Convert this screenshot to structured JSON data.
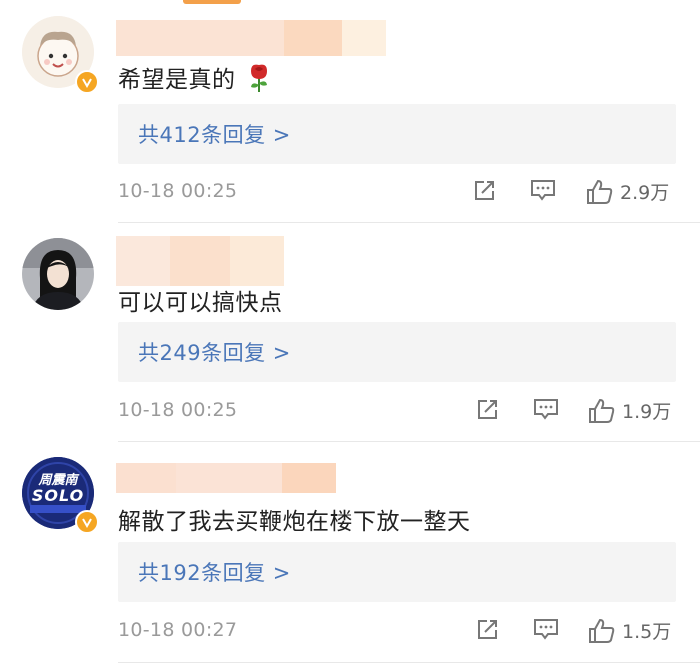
{
  "comments": [
    {
      "content": "希望是真的",
      "replies": "共412条回复 >",
      "time": "10-18 00:25",
      "likes": "2.9万"
    },
    {
      "content": "可以可以搞快点",
      "replies": "共249条回复 >",
      "time": "10-18 00:25",
      "likes": "1.9万"
    },
    {
      "content": "解散了我去买鞭炮在楼下放一整天",
      "replies": "共192条回复 >",
      "time": "10-18 00:27",
      "likes": "1.5万",
      "avatar_text": [
        "周震南",
        "SOLO"
      ]
    }
  ],
  "colors": {
    "reply_link": "#4a76b8",
    "verified_badge": "#f5a623",
    "avatar3_bg": "#1a2a78"
  },
  "icons": [
    "share-icon",
    "comment-icon",
    "like-icon",
    "rose-emoji",
    "verified-badge-icon"
  ]
}
